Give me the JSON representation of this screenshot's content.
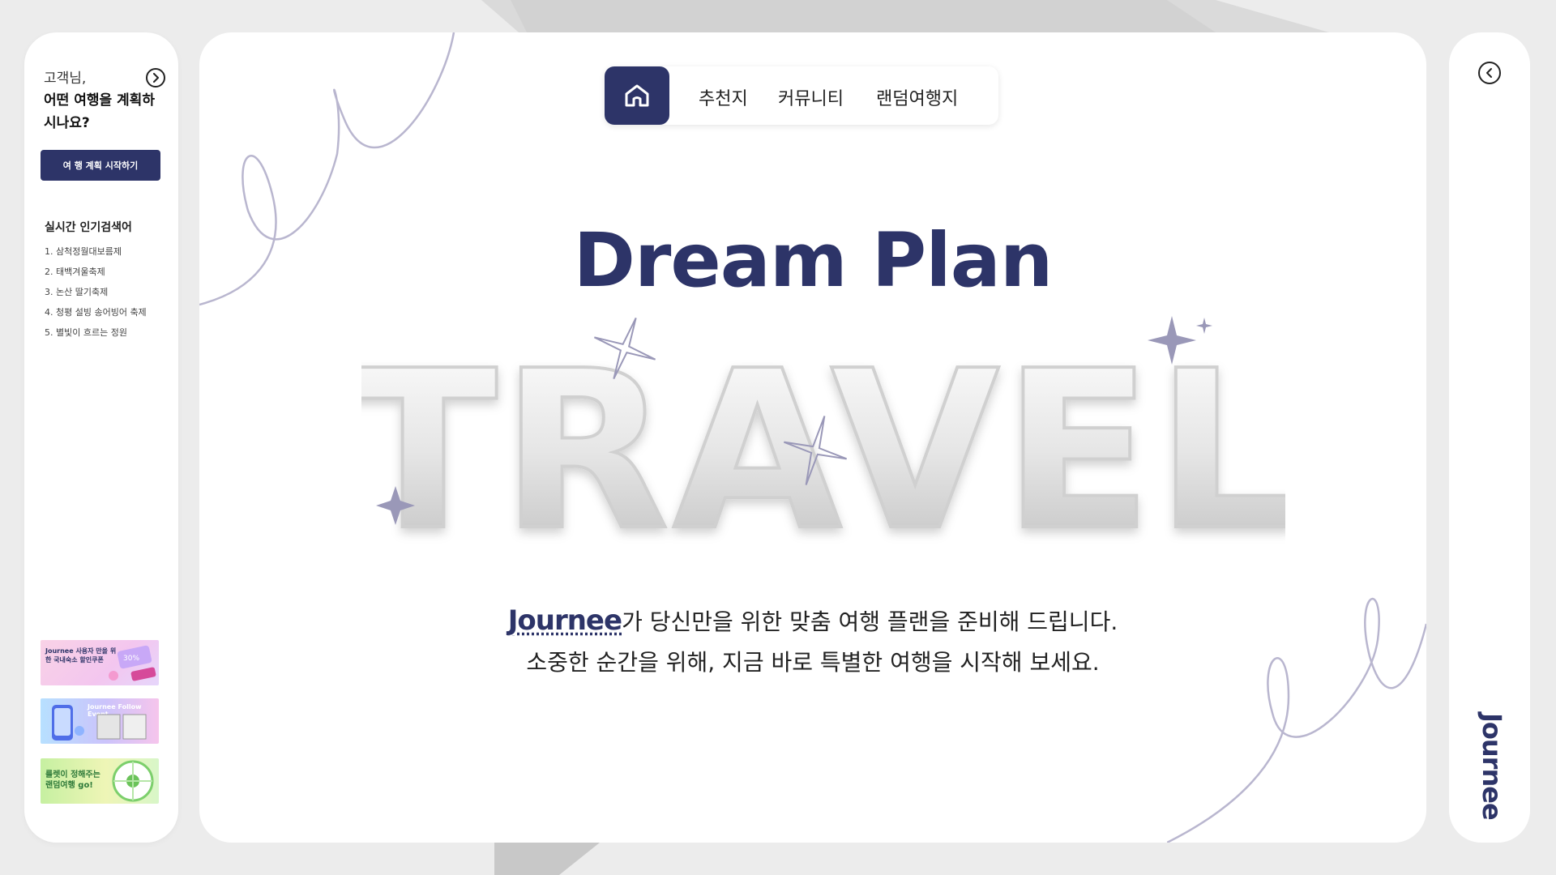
{
  "sidebar": {
    "greeting_line1": "고객님,",
    "greeting_line2": "어떤 여행을 계획하시나요?",
    "start_button": "여 행 계획 시작하기",
    "popular_title": "실시간 인기검색어",
    "popular": [
      "1. 삼척정월대보름제",
      "2. 태백겨울축제",
      "3. 논산 딸기축제",
      "4. 청평 설빙 송어빙어 축제",
      "5. 별빛이 흐르는 정원"
    ],
    "banners": [
      {
        "text": "Journee 사용자 만을 위한 국내숙소 할인쿠폰"
      },
      {
        "text": "Journee Follow Event"
      },
      {
        "text": "룰렛이 정해주는 랜덤여행 go!"
      }
    ]
  },
  "nav": {
    "home_icon": "home-icon",
    "items": [
      "추천지",
      "커뮤니티",
      "랜덤여행지"
    ]
  },
  "hero": {
    "title": "Dream Plan",
    "art_text": "TRAVEL",
    "brand": "Journee",
    "line1_rest": "가 당신만을 위한 맞춤 여행 플랜을 준비해 드립니다.",
    "line2": "소중한 순간을 위해, 지금 바로 특별한 여행을 시작해 보세요."
  },
  "right": {
    "logo": "Journee"
  },
  "colors": {
    "brand": "#2d3468",
    "background": "#ececec",
    "deco_line": "#b9b6cf"
  }
}
